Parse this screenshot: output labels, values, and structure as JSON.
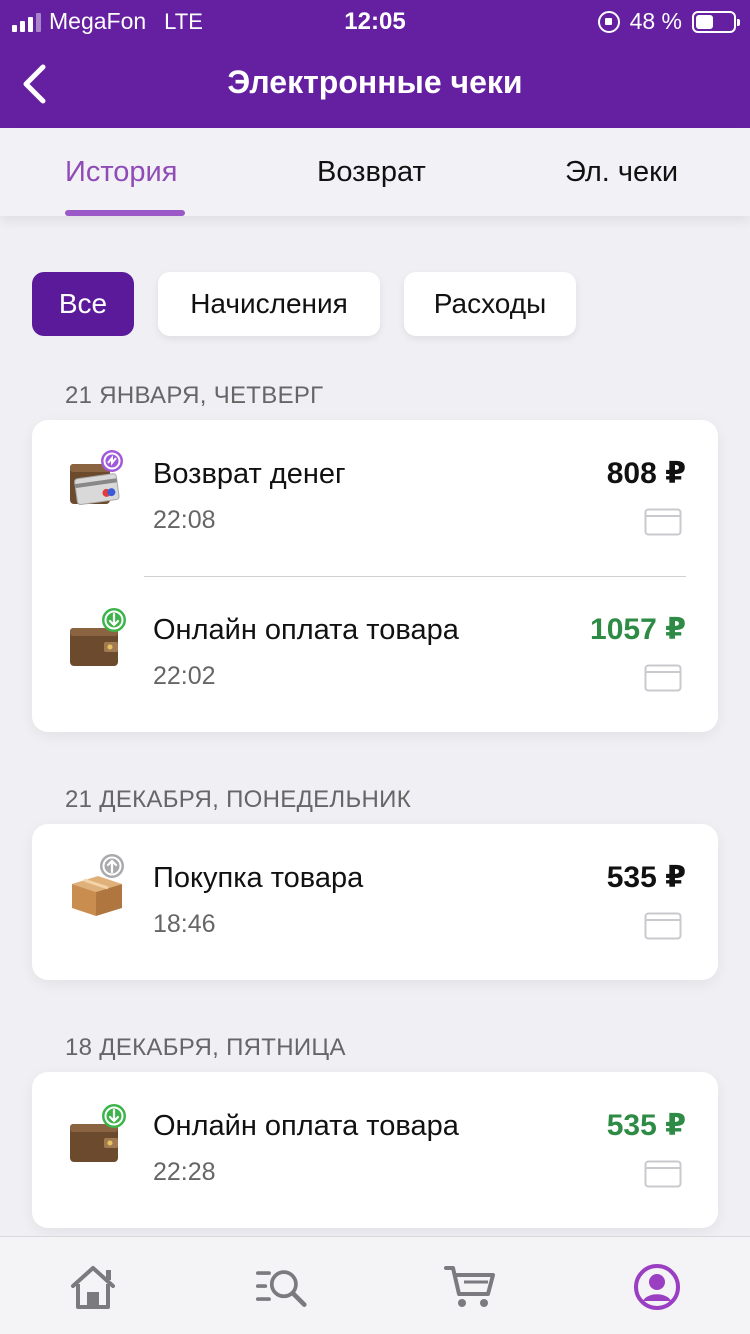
{
  "status_bar": {
    "carrier": "MegaFon",
    "network": "LTE",
    "time": "12:05",
    "battery": "48 %",
    "battery_level": 0.48
  },
  "header": {
    "title": "Электронные чеки",
    "back_icon": "chevron-left-icon"
  },
  "tabs": [
    {
      "label": "История",
      "active": true
    },
    {
      "label": "Возврат",
      "active": false
    },
    {
      "label": "Эл. чеки",
      "active": false
    }
  ],
  "filters": [
    {
      "label": "Все",
      "active": true
    },
    {
      "label": "Начисления",
      "active": false
    },
    {
      "label": "Расходы",
      "active": false
    }
  ],
  "groups": [
    {
      "date": "21 ЯНВАРЯ, ЧЕТВЕРГ",
      "items": [
        {
          "title": "Возврат денег",
          "time": "22:08",
          "amount": "808 ₽",
          "icon": "wallet-refund-icon",
          "amount_color": "#111111"
        },
        {
          "title": "Онлайн оплата товара",
          "time": "22:02",
          "amount": "1057 ₽",
          "icon": "wallet-download-icon",
          "amount_color": "#2e8b45"
        }
      ]
    },
    {
      "date": "21 ДЕКАБРЯ, ПОНЕДЕЛЬНИК",
      "items": [
        {
          "title": "Покупка товара",
          "time": "18:46",
          "amount": "535 ₽",
          "icon": "box-upload-icon",
          "amount_color": "#111111"
        }
      ]
    },
    {
      "date": "18 ДЕКАБРЯ, ПЯТНИЦА",
      "items": [
        {
          "title": "Онлайн оплата товара",
          "time": "22:28",
          "amount": "535 ₽",
          "icon": "wallet-download-icon",
          "amount_color": "#2e8b45"
        }
      ]
    }
  ],
  "bottom_nav": [
    {
      "icon": "home-icon",
      "active": false
    },
    {
      "icon": "search-list-icon",
      "active": false
    },
    {
      "icon": "cart-icon",
      "active": false
    },
    {
      "icon": "profile-icon",
      "active": true
    }
  ],
  "colors": {
    "header_bg": "#6420a0",
    "accent": "#8f4bb6",
    "chip_active": "#5a1a99",
    "positive": "#2e8b45"
  }
}
